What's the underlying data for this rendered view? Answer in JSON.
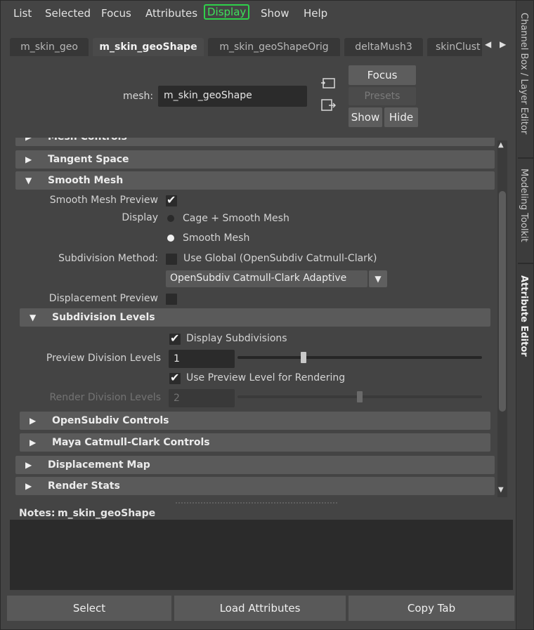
{
  "menu": {
    "items": [
      "List",
      "Selected",
      "Focus",
      "Attributes",
      "Display",
      "Show",
      "Help"
    ]
  },
  "side_panel": {
    "tabs": [
      "Channel Box / Layer Editor",
      "Modeling Toolkit",
      "Attribute Editor"
    ],
    "active": "Attribute Editor"
  },
  "tabs": {
    "items": [
      "m_skin_geo",
      "m_skin_geoShape",
      "m_skin_geoShapeOrig",
      "deltaMush3",
      "skinClust"
    ],
    "active": "m_skin_geoShape"
  },
  "header": {
    "mesh_label": "mesh:",
    "mesh_value": "m_skin_geoShape",
    "focus_label": "Focus",
    "presets_label": "Presets",
    "show_label": "Show",
    "hide_label": "Hide"
  },
  "sections": {
    "mesh_controls": "Mesh Controls",
    "tangent_space": "Tangent Space",
    "smooth_mesh": "Smooth Mesh",
    "subdivision_levels": "Subdivision Levels",
    "opensubdiv_controls": "OpenSubdiv Controls",
    "maya_catmull_clark": "Maya Catmull-Clark Controls",
    "displacement_map": "Displacement Map",
    "render_stats": "Render Stats"
  },
  "smooth_mesh": {
    "preview_label": "Smooth Mesh Preview",
    "preview_checked": true,
    "display_label": "Display",
    "display_options": [
      "Cage + Smooth Mesh",
      "Smooth Mesh"
    ],
    "display_selected": "Smooth Mesh",
    "subdiv_method_label": "Subdivision Method:",
    "use_global_label": "Use Global (OpenSubdiv Catmull-Clark)",
    "use_global_checked": false,
    "method_value": "OpenSubdiv Catmull-Clark Adaptive",
    "displacement_preview_label": "Displacement Preview",
    "displacement_preview_checked": false
  },
  "subdivision_levels": {
    "display_subdivisions_label": "Display Subdivisions",
    "display_subdivisions_checked": true,
    "preview_levels_label": "Preview Division Levels",
    "preview_levels_value": "1",
    "preview_slider_fraction": 0.27,
    "use_preview_label": "Use Preview Level for Rendering",
    "use_preview_checked": true,
    "render_levels_label": "Render Division Levels",
    "render_levels_value": "2",
    "render_slider_fraction": 0.5
  },
  "notes": {
    "label": "Notes:",
    "target": "m_skin_geoShape"
  },
  "bottom_buttons": {
    "select": "Select",
    "load_attributes": "Load Attributes",
    "copy_tab": "Copy Tab"
  }
}
